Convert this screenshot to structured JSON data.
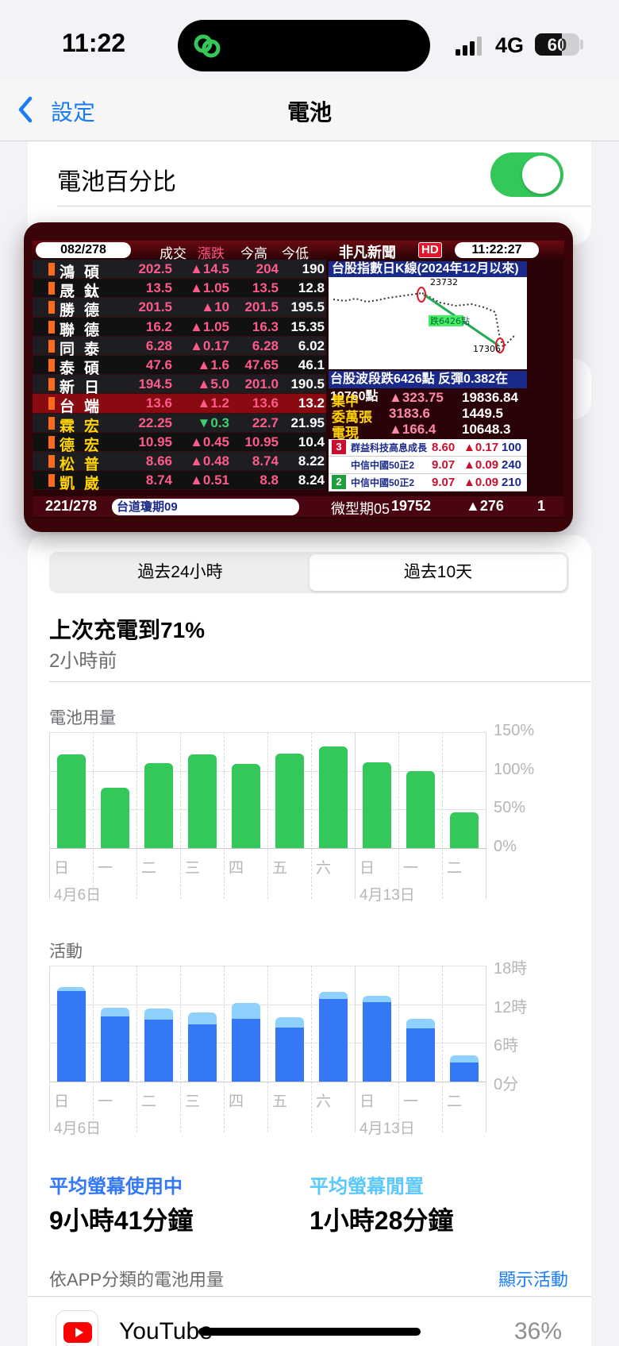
{
  "status_bar": {
    "time": "11:22",
    "network": "4G",
    "battery_percent": "60",
    "battery_level": 0.6
  },
  "nav": {
    "back_label": "設定",
    "title": "電池"
  },
  "settings": {
    "battery_percentage_label": "電池百分比",
    "battery_percentage_on": true
  },
  "tv_overlay": {
    "counter": "082/278",
    "columns": [
      "成交",
      "漲跌",
      "今高",
      "今低"
    ],
    "logo": "非凡新聞",
    "hd": "HD",
    "clock": "11:22:27",
    "rows": [
      {
        "name": "鴻碩",
        "price": "202.5",
        "change": "▲14.5",
        "high": "204",
        "low": "190",
        "yellow": false,
        "up": true
      },
      {
        "name": "晟鈦",
        "price": "13.5",
        "change": "▲1.05",
        "high": "13.5",
        "low": "12.8",
        "yellow": false,
        "up": true
      },
      {
        "name": "勝德",
        "price": "201.5",
        "change": "▲10",
        "high": "201.5",
        "low": "195.5",
        "yellow": false,
        "up": true
      },
      {
        "name": "聯德",
        "price": "16.2",
        "change": "▲1.05",
        "high": "16.3",
        "low": "15.35",
        "yellow": false,
        "up": true
      },
      {
        "name": "同泰",
        "price": "6.28",
        "change": "▲0.17",
        "high": "6.28",
        "low": "6.02",
        "yellow": false,
        "up": true
      },
      {
        "name": "泰碩",
        "price": "47.6",
        "change": "▲1.6",
        "high": "47.65",
        "low": "46.1",
        "yellow": false,
        "up": true
      },
      {
        "name": "新日興",
        "price": "194.5",
        "change": "▲5.0",
        "high": "201.0",
        "low": "190.5",
        "yellow": false,
        "up": true
      },
      {
        "name": "台端",
        "price": "13.6",
        "change": "▲1.2",
        "high": "13.6",
        "low": "13.2",
        "yellow": false,
        "up": true
      },
      {
        "name": "霖宏",
        "price": "22.25",
        "change": "▼0.3",
        "high": "22.7",
        "low": "21.95",
        "yellow": true,
        "up": false
      },
      {
        "name": "德宏",
        "price": "10.95",
        "change": "▲0.45",
        "high": "10.95",
        "low": "10.4",
        "yellow": true,
        "up": true
      },
      {
        "name": "松普",
        "price": "8.66",
        "change": "▲0.48",
        "high": "8.74",
        "low": "8.22",
        "yellow": true,
        "up": true
      },
      {
        "name": "凱崴",
        "price": "8.74",
        "change": "▲0.51",
        "high": "8.8",
        "low": "8.24",
        "yellow": true,
        "up": true
      }
    ],
    "chart_title": "台股指數日K線(2024年12月以來)",
    "chart_high": "23732",
    "chart_low": "17306",
    "chart_drop_label": "跌6426點",
    "chart_note": "台股波段跌6426點 反彈0.382在19760點",
    "index_rows": [
      {
        "name": "集中",
        "change": "▲323.75",
        "value": "19836.84"
      },
      {
        "name": "委萬張",
        "change": "3183.6",
        "value": "1449.5"
      },
      {
        "name": "電現",
        "change": "▲166.4",
        "value": "10648.3"
      }
    ],
    "etf_rows": [
      {
        "rank": "3",
        "name": "群益科技高息成長",
        "price": "8.60",
        "change": "▲0.17",
        "vol": "100"
      },
      {
        "rank": "",
        "name": "中信中國50正2",
        "price": "9.07",
        "change": "▲0.09",
        "vol": "240"
      },
      {
        "rank": "2",
        "name": "中信中國50正2",
        "price": "9.07",
        "change": "▲0.09",
        "vol": "210"
      }
    ],
    "footer_counter": "221/278",
    "footer_ticker": "台道瓊期09",
    "footer_futures_name": "微型期05",
    "footer_futures_value": "19752",
    "footer_futures_change": "▲276",
    "footer_page": "1"
  },
  "segment": {
    "options": [
      "過去24小時",
      "過去10天"
    ],
    "selected": 1
  },
  "last_charge": {
    "title": "上次充電到71%",
    "subtitle": "2小時前"
  },
  "usage_chart_title": "電池用量",
  "activity_chart_title": "活動",
  "stats": {
    "screen_active_label": "平均螢幕使用中",
    "screen_active_value": "9小時41分鐘",
    "screen_idle_label": "平均螢幕閒置",
    "screen_idle_value": "1小時28分鐘"
  },
  "app_usage": {
    "header": "依APP分類的電池用量",
    "show_activity": "顯示活動",
    "apps": [
      {
        "name": "YouTube",
        "percent": "36%"
      }
    ]
  },
  "colors": {
    "green": "#34c759",
    "blue": "#3478f6",
    "light_blue": "#8ed1fc",
    "accent": "#1a7cf5"
  },
  "chart_data": [
    {
      "type": "bar",
      "title": "電池用量",
      "categories": [
        "日",
        "一",
        "二",
        "三",
        "四",
        "五",
        "六",
        "日",
        "一",
        "二"
      ],
      "date_labels": [
        {
          "index": 0,
          "text": "4月6日"
        },
        {
          "index": 7,
          "text": "4月13日"
        }
      ],
      "yticks": [
        "150%",
        "100%",
        "50%",
        "0%"
      ],
      "ylim": [
        0,
        150
      ],
      "series": [
        {
          "values": [
            121,
            78,
            110,
            121,
            109,
            122,
            131,
            111,
            100,
            46
          ]
        }
      ]
    },
    {
      "type": "bar",
      "stacked": true,
      "title": "活動",
      "categories": [
        "日",
        "一",
        "二",
        "三",
        "四",
        "五",
        "六",
        "日",
        "一",
        "二"
      ],
      "date_labels": [
        {
          "index": 0,
          "text": "4月6日"
        },
        {
          "index": 7,
          "text": "4月13日"
        }
      ],
      "yticks": [
        "18時",
        "12時",
        "6時",
        "0分"
      ],
      "ylim": [
        0,
        18
      ],
      "series": [
        {
          "name": "平均螢幕使用中",
          "values": [
            14.1,
            10.1,
            9.6,
            8.9,
            9.8,
            8.4,
            12.8,
            12.3,
            8.2,
            3.0
          ]
        },
        {
          "name": "平均螢幕閒置",
          "values": [
            0.6,
            1.4,
            1.8,
            1.8,
            2.4,
            1.6,
            1.1,
            1.0,
            1.6,
            1.1
          ]
        }
      ]
    }
  ]
}
